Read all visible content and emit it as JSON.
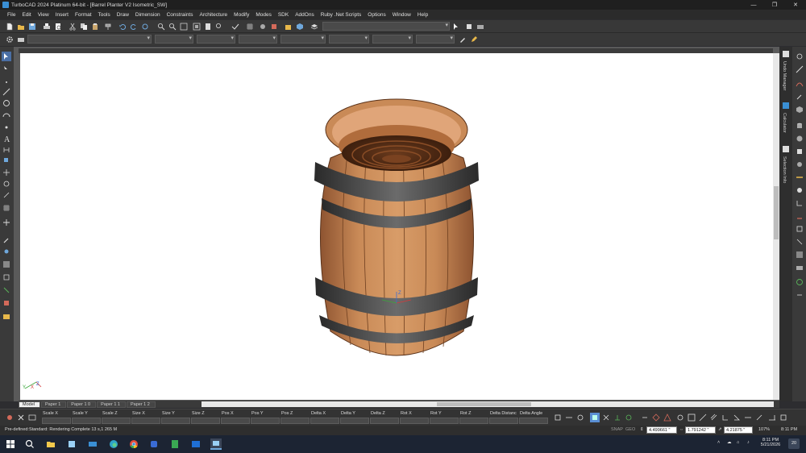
{
  "window": {
    "title": "TurboCAD 2024 Platinum 64-bit - [Barrel Planter V2 Isometric_SW]",
    "controls": [
      "—",
      "❐",
      "✕"
    ]
  },
  "menu": [
    "File",
    "Edit",
    "View",
    "Insert",
    "Format",
    "Tools",
    "Draw",
    "Dimension",
    "Constraints",
    "Architecture",
    "Modify",
    "Modes",
    "SDK",
    "AddOns",
    "Ruby .Net Scripts",
    "Options",
    "Window",
    "Help"
  ],
  "right_panel_tabs": [
    "Undo Manager",
    "Calculator",
    "Selection Info"
  ],
  "canvas": {
    "background": "#ffffff",
    "axis_label": "Z",
    "ucs_labels": [
      "Y",
      "X",
      "Z"
    ]
  },
  "tabs": [
    "Model",
    "Paper 1",
    "Paper 1 0",
    "Paper 1 1",
    "Paper 1 2"
  ],
  "inspector_fields": [
    "Scale X",
    "Scale Y",
    "Scale Z",
    "Size X",
    "Size Y",
    "Size Z",
    "Pos X",
    "Pos Y",
    "Pos Z",
    "Delta X",
    "Delta Y",
    "Delta Z",
    "Rot X",
    "Rot Y",
    "Rot Z",
    "Delta Distanc",
    "Delta Angle"
  ],
  "status": {
    "message": "Pre-defined:Standard: Rendering Complete 13 s,1 265 M",
    "snap": "SNAP",
    "geo": "GEO",
    "x_value": "4.499661 \"",
    "y_value": "1.791242 \"",
    "z_value": "4.21875 \"",
    "zoom": "107%",
    "time": "8:11 PM"
  },
  "taskbar": {
    "time": "8:11 PM",
    "date": "5/21/2026",
    "notification_count": "20"
  },
  "colors": {
    "wood": "#c98a57",
    "wood_dark": "#8e5431",
    "band": "#4a4a4a",
    "accent": "#3a8fd4"
  }
}
